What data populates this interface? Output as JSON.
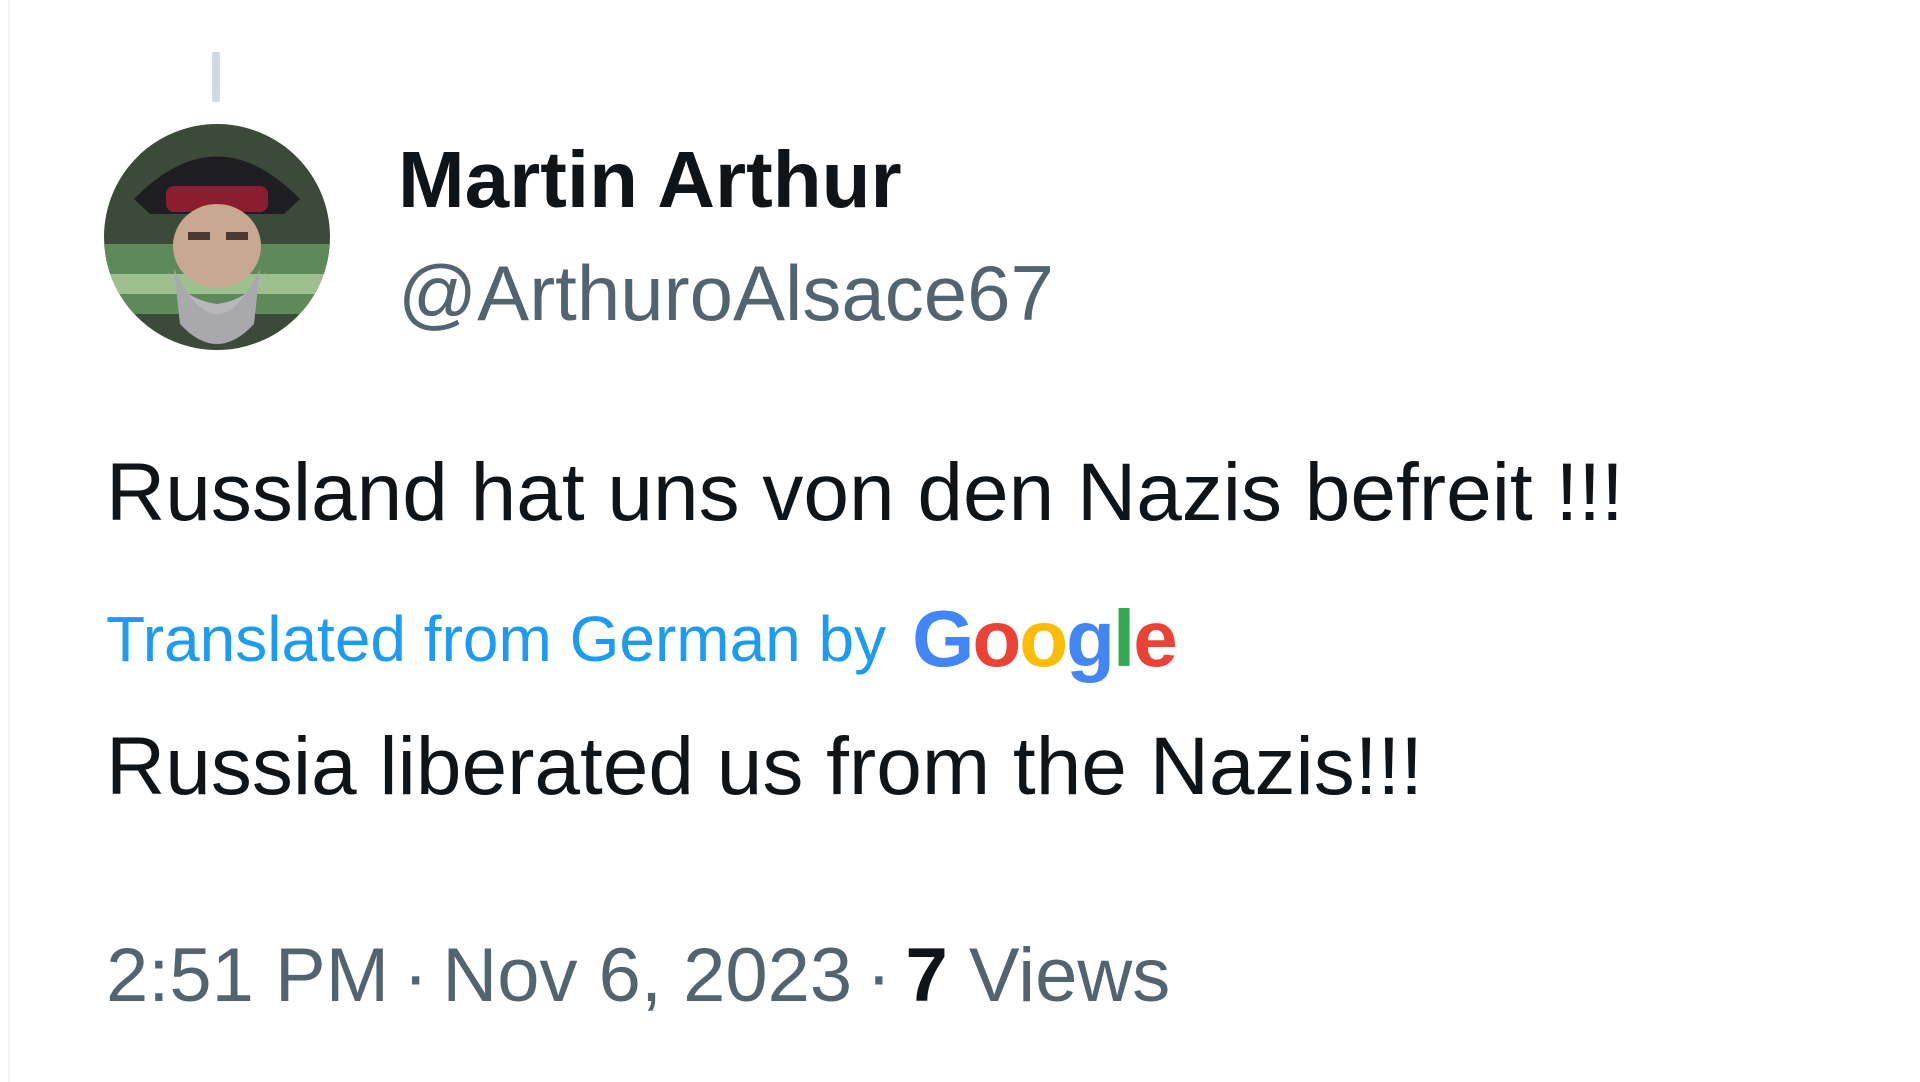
{
  "tweet": {
    "author": {
      "display_name": "Martin Arthur",
      "handle": "@ArthuroAlsace67"
    },
    "text": "Russland hat uns von den Nazis befreit !!!",
    "translation": {
      "label": "Translated from German by",
      "provider_letters": [
        {
          "char": "G",
          "color": "#4285f4"
        },
        {
          "char": "o",
          "color": "#ea4335"
        },
        {
          "char": "o",
          "color": "#fbbc05"
        },
        {
          "char": "g",
          "color": "#4285f4"
        },
        {
          "char": "l",
          "color": "#34a853"
        },
        {
          "char": "e",
          "color": "#ea4335"
        }
      ],
      "text": "Russia liberated us from the Nazis!!!"
    },
    "meta": {
      "time": "2:51 PM",
      "separator": "·",
      "date": "Nov 6, 2023",
      "views_count": "7",
      "views_label": "Views"
    }
  },
  "colors": {
    "primary_text": "#0f1419",
    "secondary_text": "#536471",
    "link_blue": "#1d9bf0"
  }
}
